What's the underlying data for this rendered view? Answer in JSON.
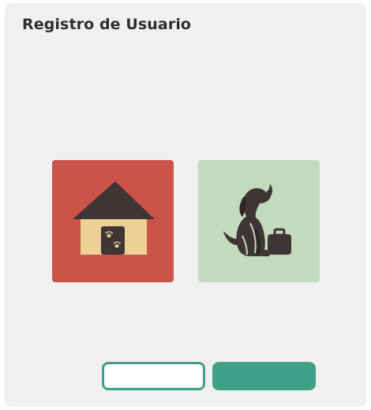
{
  "header": {
    "title": "Registro de Usuario"
  },
  "options": [
    {
      "id": "home",
      "icon": "doghouse-icon",
      "color": "#cb534a"
    },
    {
      "id": "travel",
      "icon": "dog-with-suitcase-icon",
      "color": "#c3dbbd"
    }
  ],
  "buttons": {
    "secondary_label": "",
    "primary_label": ""
  },
  "colors": {
    "panel_bg": "#f0f0f0",
    "accent": "#3f9f88",
    "icon_dark": "#3f3535",
    "house_wall": "#ecd096",
    "paw": "#ecd096"
  }
}
